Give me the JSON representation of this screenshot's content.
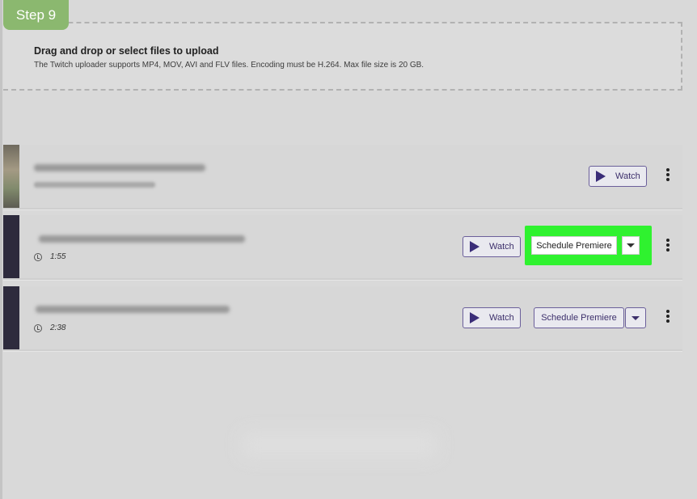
{
  "step_badge": "Step 9",
  "upload": {
    "title": "Drag and drop or select files to upload",
    "subtitle": "The Twitch uploader supports MP4, MOV, AVI and FLV files. Encoding must be H.264. Max file size is 20 GB."
  },
  "videos": [
    {
      "duration": "",
      "watch_label": "Watch"
    },
    {
      "duration": "1:55",
      "watch_label": "Watch",
      "schedule_label": "Schedule Premiere"
    },
    {
      "duration": "2:38",
      "watch_label": "Watch",
      "schedule_label": "Schedule Premiere"
    }
  ],
  "colors": {
    "highlight": "#2ff22f",
    "badge": "#8bb86f",
    "accent": "#3a2d78"
  }
}
